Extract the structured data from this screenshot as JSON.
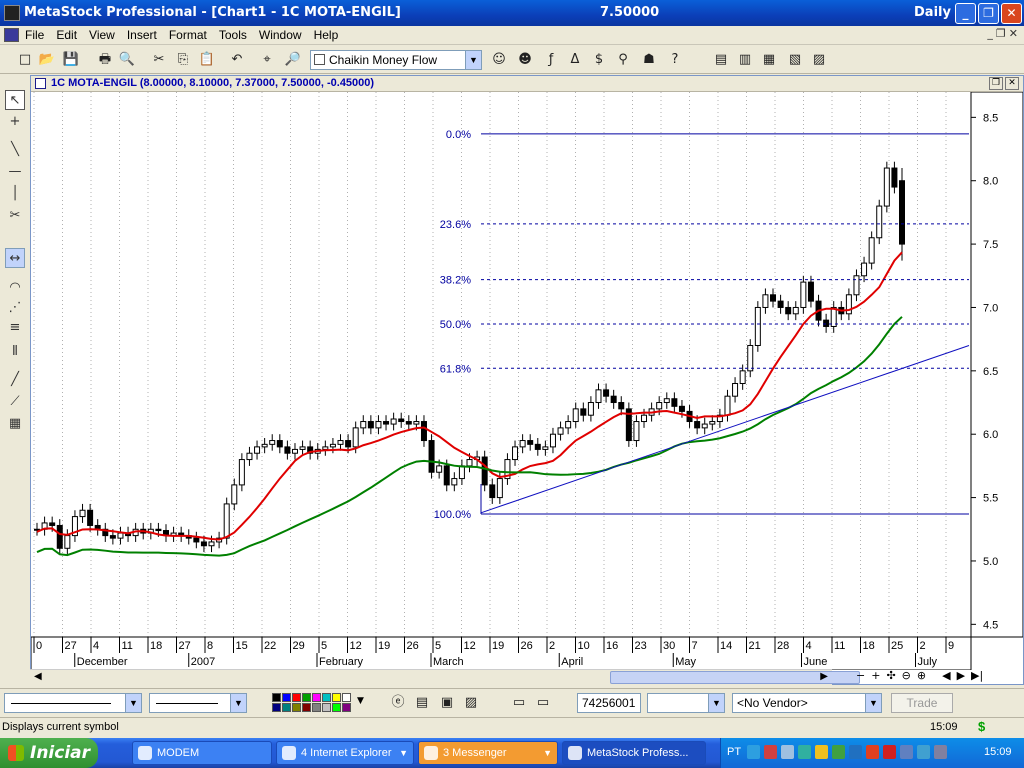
{
  "window": {
    "app_title": "MetaStock Professional - [Chart1 - 1C MOTA-ENGIL]",
    "price": "7.50000",
    "periodicity": "Daily"
  },
  "menu": [
    "File",
    "Edit",
    "View",
    "Insert",
    "Format",
    "Tools",
    "Window",
    "Help"
  ],
  "toolbar": {
    "indicator_selected": "Chaikin Money Flow",
    "icons": [
      "new-icon",
      "open-icon",
      "save-icon",
      "print-icon",
      "print-preview-icon",
      "cut-icon",
      "copy-icon",
      "paste-icon",
      "undo-icon",
      "crosshair-icon",
      "zoom-icon",
      "indicator-builder-icon",
      "expert-advisor-icon",
      "formula-icon",
      "explorer-icon",
      "system-tester-icon",
      "binoculars-icon",
      "smart-charts-icon",
      "help-icon",
      "cascade-icon",
      "tile-vertical-icon",
      "tile-horizontal-icon",
      "tile-icon",
      "layout-icon"
    ]
  },
  "chart": {
    "header": "1C MOTA-ENGIL (8.00000, 8.10000, 7.37000, 7.50000, -0.45000)",
    "fib_labels": [
      "0.0%",
      "23.6%",
      "38.2%",
      "50.0%",
      "61.8%",
      "100.0%"
    ],
    "y_ticks": [
      "8.5",
      "8.0",
      "7.5",
      "7.0",
      "6.5",
      "6.0",
      "5.5",
      "5.0",
      "4.5"
    ],
    "x_day_ticks": [
      "0",
      "27",
      "4",
      "11",
      "18",
      "27",
      "8",
      "15",
      "22",
      "29",
      "5",
      "12",
      "19",
      "26",
      "5",
      "12",
      "19",
      "26",
      "2",
      "10",
      "16",
      "23",
      "30",
      "7",
      "14",
      "21",
      "28",
      "4",
      "11",
      "18",
      "25",
      "2",
      "9"
    ],
    "x_month_ticks": [
      "December",
      "2007",
      "February",
      "March",
      "April",
      "May",
      "June",
      "July"
    ],
    "colors": {
      "ma_fast": "#e00000",
      "ma_slow": "#008000",
      "fib": "#0000a0",
      "trendline": "#1010c0"
    }
  },
  "chart_data": {
    "type": "candlestick",
    "title": "1C MOTA-ENGIL",
    "periodicity": "Daily",
    "last_bar": {
      "open": 8.0,
      "high": 8.1,
      "low": 7.37,
      "close": 7.5,
      "change": -0.45
    },
    "ylim": [
      4.4,
      8.7
    ],
    "fibonacci_retracement": {
      "high": 8.37,
      "low": 5.37,
      "levels": [
        {
          "label": "0.0%",
          "value": 8.37
        },
        {
          "label": "23.6%",
          "value": 7.66
        },
        {
          "label": "38.2%",
          "value": 7.22
        },
        {
          "label": "50.0%",
          "value": 6.87
        },
        {
          "label": "61.8%",
          "value": 6.52
        },
        {
          "label": "100.0%",
          "value": 5.37
        }
      ]
    },
    "closes_approx": [
      5.25,
      5.3,
      5.28,
      5.1,
      5.2,
      5.35,
      5.4,
      5.28,
      5.25,
      5.2,
      5.18,
      5.22,
      5.2,
      5.25,
      5.22,
      5.25,
      5.24,
      5.2,
      5.22,
      5.2,
      5.18,
      5.15,
      5.12,
      5.15,
      5.18,
      5.45,
      5.6,
      5.8,
      5.85,
      5.9,
      5.92,
      5.95,
      5.9,
      5.85,
      5.88,
      5.9,
      5.85,
      5.88,
      5.9,
      5.92,
      5.95,
      5.9,
      6.05,
      6.1,
      6.05,
      6.1,
      6.08,
      6.12,
      6.1,
      6.08,
      6.1,
      5.95,
      5.7,
      5.75,
      5.6,
      5.65,
      5.75,
      5.8,
      5.82,
      5.6,
      5.5,
      5.65,
      5.8,
      5.9,
      5.95,
      5.92,
      5.88,
      5.9,
      6.0,
      6.05,
      6.1,
      6.2,
      6.15,
      6.25,
      6.35,
      6.3,
      6.25,
      6.2,
      5.95,
      6.1,
      6.15,
      6.2,
      6.25,
      6.28,
      6.22,
      6.18,
      6.1,
      6.05,
      6.08,
      6.1,
      6.15,
      6.3,
      6.4,
      6.5,
      6.7,
      7.0,
      7.1,
      7.05,
      7.0,
      6.95,
      7.0,
      7.2,
      7.05,
      6.9,
      6.85,
      7.0,
      6.95,
      7.1,
      7.25,
      7.35,
      7.55,
      7.8,
      8.1,
      7.95,
      7.5
    ],
    "moving_averages": [
      {
        "name": "red moving average",
        "color": "#e00000"
      },
      {
        "name": "green moving average",
        "color": "#008000"
      }
    ],
    "trendline": {
      "from": {
        "date": "2007-03-13",
        "value": 5.38
      },
      "to": {
        "date": "2007-07-12",
        "value": 6.7
      }
    }
  },
  "bottom_toolbar": {
    "line_style_1": "",
    "line_style_2": "",
    "security_code": "74256001",
    "vendor": "<No Vendor>",
    "trade_label": "Trade",
    "palette": [
      "#000000",
      "#0000ff",
      "#ff0000",
      "#00a000",
      "#ff00ff",
      "#00c0c0",
      "#ffff00",
      "#ffffff",
      "#000080",
      "#008080",
      "#808000",
      "#800000",
      "#808080",
      "#c0c0c0",
      "#00ff00",
      "#800080"
    ]
  },
  "status": {
    "message": "Displays current symbol",
    "time": "15:09",
    "currency": "$"
  },
  "taskbar": {
    "start_label": "Iniciar",
    "tasks": [
      {
        "label": "MODEM",
        "icon": "modem-icon"
      },
      {
        "label": "4 Internet Explorer",
        "icon": "internet-explorer-icon"
      },
      {
        "label": "3 Messenger",
        "icon": "messenger-icon"
      },
      {
        "label": "MetaStock Profess...",
        "icon": "metastock-icon"
      }
    ],
    "language": "PT",
    "clock": "15:09"
  }
}
